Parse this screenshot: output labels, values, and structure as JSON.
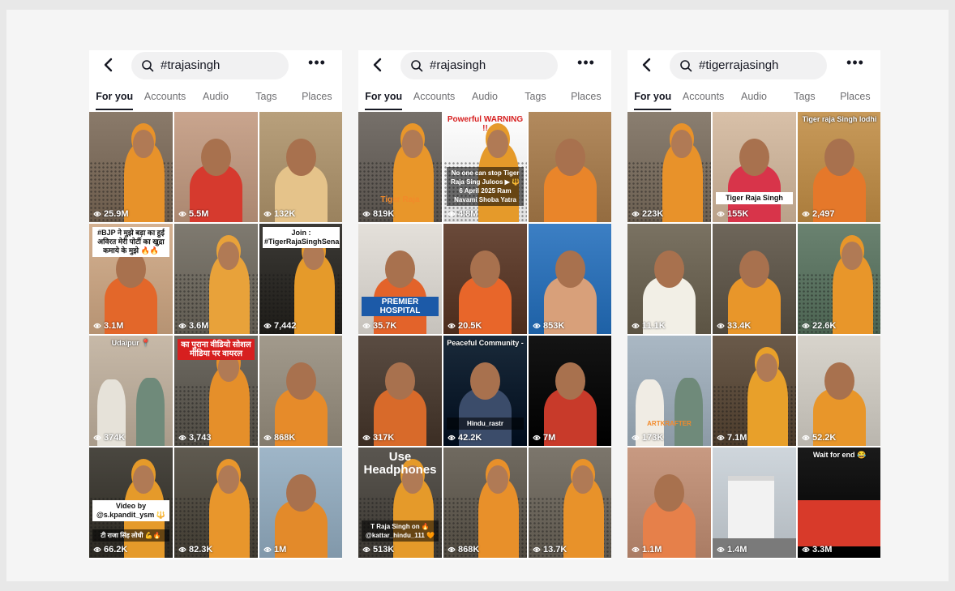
{
  "colors": {
    "background": "#f5f5f5",
    "text": "#161823",
    "muted": "#6f6f72",
    "pill": "#f1f1f2"
  },
  "phones": [
    {
      "query": "#trajasingh",
      "tabs": [
        "For you",
        "Accounts",
        "Audio",
        "Tags",
        "Places"
      ],
      "active_tab": 0,
      "tiles": [
        {
          "views": "25.9M",
          "bg": "#8a7a6a",
          "accent": "#e7922a",
          "style": "crowd"
        },
        {
          "views": "5.5M",
          "bg": "#c9a58e",
          "accent": "#d63a2e",
          "style": "portrait"
        },
        {
          "views": "132K",
          "bg": "#b8a07c",
          "accent": "#e5c38a",
          "style": "portrait"
        },
        {
          "views": "3.1M",
          "bg": "#d4b191",
          "accent": "#e3672a",
          "style": "portrait",
          "overlay": "#BJP ने मुझे बड़ा का हुई अविरत मेरी पोर्टी का खुद्रा कमाये के मुझे 🔥🔥",
          "overlay_pos": "top",
          "overlay_style": "dark"
        },
        {
          "views": "3.6M",
          "bg": "#7f7a70",
          "accent": "#e8a23a",
          "style": "crowd"
        },
        {
          "views": "7,442",
          "bg": "#3c3a36",
          "accent": "#e59a2a",
          "style": "crowd",
          "overlay": "Join : #TigerRajaSinghSena",
          "overlay_pos": "top",
          "overlay_style": "light"
        },
        {
          "views": "374K",
          "bg": "#c7b9a8",
          "accent": "#e6e2d9",
          "style": "pair",
          "overlay": "Udaipur 📍",
          "overlay_pos": "top",
          "overlay_style": "plain"
        },
        {
          "views": "3,743",
          "bg": "#6e6a62",
          "accent": "#e58f2a",
          "style": "crowd",
          "overlay": "का पुराना वीडियो सोशल मीडिया पर वायरल",
          "overlay_pos": "top",
          "overlay_style": "red"
        },
        {
          "views": "868K",
          "bg": "#a29a8c",
          "accent": "#e68b2a",
          "style": "portrait"
        },
        {
          "views": "66.2K",
          "bg": "#4a4740",
          "accent": "#e59a2a",
          "style": "crowd",
          "overlay": "Video by @s.kpandit_ysm 🔱",
          "overlay_pos": "middle",
          "overlay_style": "light",
          "overlay2": "टी राजा सिंह लोधी 💪🔥"
        },
        {
          "views": "82.3K",
          "bg": "#5f5a50",
          "accent": "#e8962c",
          "style": "crowd"
        },
        {
          "views": "1M",
          "bg": "#9fb6c8",
          "accent": "#e38a2a",
          "style": "portrait"
        }
      ]
    },
    {
      "query": "#rajasingh",
      "tabs": [
        "For you",
        "Accounts",
        "Audio",
        "Tags",
        "Places"
      ],
      "active_tab": 0,
      "tiles": [
        {
          "views": "819K",
          "bg": "#76706a",
          "accent": "#e8962a",
          "style": "crowd",
          "overlay": "Tiger Raja",
          "overlay_pos": "bottom",
          "overlay_style": "orange"
        },
        {
          "views": "4.8M",
          "bg": "#ffffff",
          "accent": "#e59a2a",
          "style": "crowd",
          "overlay": "Powerful WARNING !!",
          "overlay_pos": "top",
          "overlay_style": "redtext",
          "overlay2": "No one can stop Tiger Raja Sing Juloos ▶ 🔱 6 April 2025 Ram Navami Shoba Yatra"
        },
        {
          "views": "",
          "bg": "#b28a5e",
          "accent": "#e9852a",
          "style": "portrait"
        },
        {
          "views": "35.7K",
          "bg": "#e4e0da",
          "accent": "#e3632a",
          "style": "portrait",
          "overlay": "PREMIER HOSPITAL",
          "overlay_pos": "bottom",
          "overlay_style": "blue"
        },
        {
          "views": "20.5K",
          "bg": "#6a4a3a",
          "accent": "#e8662a",
          "style": "portrait"
        },
        {
          "views": "853K",
          "bg": "#3c7fc4",
          "accent": "#d8a07a",
          "style": "portrait"
        },
        {
          "views": "317K",
          "bg": "#5a4c42",
          "accent": "#d86a2a",
          "style": "portrait"
        },
        {
          "views": "42.2K",
          "bg": "#1a2a3a",
          "accent": "#3b4c6a",
          "style": "portrait",
          "overlay": "Peaceful Community -",
          "overlay_pos": "top",
          "overlay_style": "plain",
          "overlay2": "Hindu_rastr"
        },
        {
          "views": "7M",
          "bg": "#141414",
          "accent": "#c83a2a",
          "style": "portrait"
        },
        {
          "views": "513K",
          "bg": "#5a5650",
          "accent": "#e59a2a",
          "style": "crowd",
          "overlay": "Use Headphones",
          "overlay_pos": "top",
          "overlay_style": "bigwhite",
          "overlay2": "T Raja Singh on 🔥 @kattar_hindu_111 🧡"
        },
        {
          "views": "868K",
          "bg": "#706a60",
          "accent": "#e8902a",
          "style": "crowd"
        },
        {
          "views": "13.7K",
          "bg": "#7c766c",
          "accent": "#e8922a",
          "style": "crowd"
        }
      ]
    },
    {
      "query": "#tigerrajasingh",
      "tabs": [
        "For you",
        "Accounts",
        "Audio",
        "Tags",
        "Places"
      ],
      "active_tab": 0,
      "tiles": [
        {
          "views": "223K",
          "bg": "#8a7e70",
          "accent": "#e8922a",
          "style": "crowd"
        },
        {
          "views": "155K",
          "bg": "#d8c0a8",
          "accent": "#d8344a",
          "style": "portrait",
          "overlay": "Tiger Raja Singh",
          "overlay_pos": "bottom",
          "overlay_style": "dark"
        },
        {
          "views": "2,497",
          "bg": "#c89a5a",
          "accent": "#e5782a",
          "style": "portrait",
          "overlay": "Tiger raja Singh lodhi",
          "overlay_pos": "top",
          "overlay_style": "plain"
        },
        {
          "views": "11.1K",
          "bg": "#7a7262",
          "accent": "#f2efe6",
          "style": "portrait"
        },
        {
          "views": "33.4K",
          "bg": "#6e665a",
          "accent": "#e8962a",
          "style": "portrait"
        },
        {
          "views": "22.6K",
          "bg": "#6a8270",
          "accent": "#e8962a",
          "style": "crowd"
        },
        {
          "views": "173K",
          "bg": "#aab8c4",
          "accent": "#f0ece4",
          "style": "pair",
          "overlay": "ARTKRAFTER",
          "overlay_pos": "bottom",
          "overlay_style": "orangetext"
        },
        {
          "views": "7.1M",
          "bg": "#6a5a4a",
          "accent": "#e8a02a",
          "style": "crowd"
        },
        {
          "views": "52.2K",
          "bg": "#d8d4cc",
          "accent": "#e8962a",
          "style": "portrait"
        },
        {
          "views": "1.1M",
          "bg": "#c89a82",
          "accent": "#e6804a",
          "style": "portrait"
        },
        {
          "views": "1.4M",
          "bg": "#cfd6dc",
          "accent": "#e8e8e8",
          "style": "building"
        },
        {
          "views": "3.3M",
          "bg": "#1a1a1a",
          "accent": "#d83a2a",
          "style": "stage",
          "overlay": "Wait for end 😂",
          "overlay_pos": "top",
          "overlay_style": "plain"
        }
      ]
    }
  ]
}
